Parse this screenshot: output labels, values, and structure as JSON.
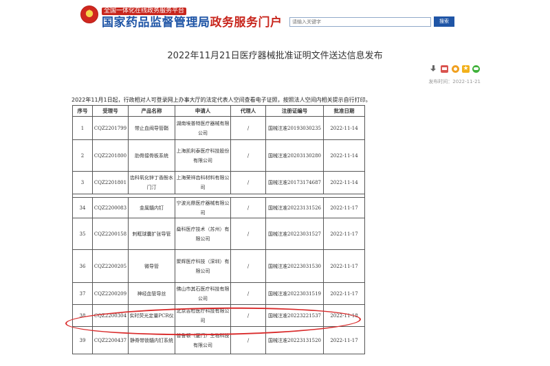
{
  "header": {
    "portal_subtitle": "全国一体化在线政务服务平台",
    "portal_title_blue": "国家药品监督管理局",
    "portal_title_red": "政务服务门户",
    "search_placeholder": "请输入关键字",
    "search_button": "搜索"
  },
  "article": {
    "title": "2022年11月21日医疗器械批准证明文件送达信息发布",
    "publish_time": "发布时间：2022-11-21",
    "intro": "2022年11月1日起，行政相对人可登录网上办事大厅的法定代表人空间查看电子证照，按照法人空间内相关提示自行打印。"
  },
  "share_icons": [
    "download-icon",
    "print-icon",
    "weibo-icon",
    "favorite-icon",
    "wechat-icon"
  ],
  "table": {
    "headers": [
      "序号",
      "受理号",
      "产品名称",
      "申请人",
      "代理人",
      "注册证编号",
      "批准日期"
    ],
    "rows": [
      {
        "no": "1",
        "accept": "CQZ2201799",
        "product": "带止血阀导管鞘",
        "applicant": "湖南埃普特医疗器械有限公司",
        "agent": "/",
        "cert": "国械注准20193030235",
        "date": "2022-11-14"
      },
      {
        "no": "2",
        "accept": "CQZ2201800",
        "product": "肋骨接骨板系统",
        "applicant": "上海凯利泰医疗科技股份有限公司",
        "agent": "/",
        "cert": "国械注准20203130280",
        "date": "2022-11-14"
      },
      {
        "no": "3",
        "accept": "CQZ2201801",
        "product": "齿科氧化锌丁香酚水门汀",
        "applicant": "上海荣祥齿科材料有限公司",
        "agent": "/",
        "cert": "国械注准20173174687",
        "date": "2022-11-14"
      },
      {
        "no": "34",
        "accept": "CQZ2200083",
        "product": "金属髓内钉",
        "applicant": "宁波光鼎医疗器械有限公司",
        "agent": "/",
        "cert": "国械注准20223131526",
        "date": "2022-11-17"
      },
      {
        "no": "35",
        "accept": "CQZ2200158",
        "product": "刺眶球囊扩张导管",
        "applicant": "燊科医疗技术（苏州）有限公司",
        "agent": "/",
        "cert": "国械注准20223031527",
        "date": "2022-11-17"
      },
      {
        "no": "36",
        "accept": "CQZ2200205",
        "product": "微导管",
        "applicant": "聚辉医疗科技（深圳）有限公司",
        "agent": "/",
        "cert": "国械注准20223031530",
        "date": "2022-11-17"
      },
      {
        "no": "37",
        "accept": "CQZ2200209",
        "product": "神经血管导丝",
        "applicant": "佛山市其石医疗科技有限公司",
        "agent": "/",
        "cert": "国械注准20223031519",
        "date": "2022-11-17"
      },
      {
        "no": "38",
        "accept": "CQZ2200304",
        "product": "实时荧光定量PCR仪",
        "applicant": "北京吉检医疗科技有限公司",
        "agent": "/",
        "cert": "国械注准20223221537",
        "date": "2022-11-18"
      },
      {
        "no": "39",
        "accept": "CQZ2200437",
        "product": "静脊带锁髓内钉系统",
        "applicant": "普鲁顿（厦门）生物科技有限公司",
        "agent": "/",
        "cert": "国械注准20223131520",
        "date": "2022-11-17"
      }
    ]
  }
}
